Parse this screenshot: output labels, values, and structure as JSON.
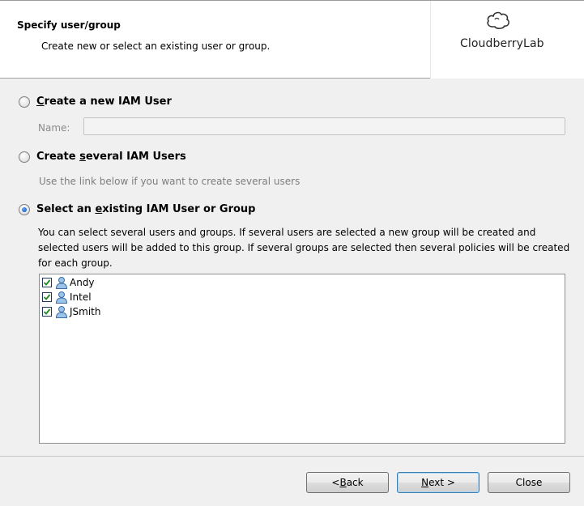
{
  "header": {
    "title": "Specify user/group",
    "subtitle": "Create new or select an existing user or group.",
    "logo_text": "CloudberryLab"
  },
  "options": {
    "create_new": {
      "label_pre": "",
      "label_key": "C",
      "label_post": "reate a new IAM User",
      "checked": false
    },
    "name_label": "Name:",
    "name_value": "",
    "create_several": {
      "label_pre": "Create ",
      "label_key": "s",
      "label_post": "everal IAM Users",
      "checked": false
    },
    "several_hint": "Use the link below if you want to create several users",
    "select_existing": {
      "label_pre": "Select an ",
      "label_key": "e",
      "label_post": "xisting IAM User or Group",
      "checked": true
    },
    "description": "You can select several users and groups. If several users are selected a new group will be created and selected users will be added to this group. If several groups are selected then several policies will be created for each group."
  },
  "users": [
    {
      "name": "Andy",
      "checked": true,
      "icon": "user-icon"
    },
    {
      "name": "Intel",
      "checked": true,
      "icon": "user-icon"
    },
    {
      "name": "JSmith",
      "checked": true,
      "icon": "user-icon"
    }
  ],
  "buttons": {
    "back_pre": "< ",
    "back_key": "B",
    "back_post": "ack",
    "next_key": "N",
    "next_post": "ext >",
    "close": "Close"
  },
  "colors": {
    "accent": "#0b4fb0",
    "disabled_text": "#8a8a8a"
  }
}
